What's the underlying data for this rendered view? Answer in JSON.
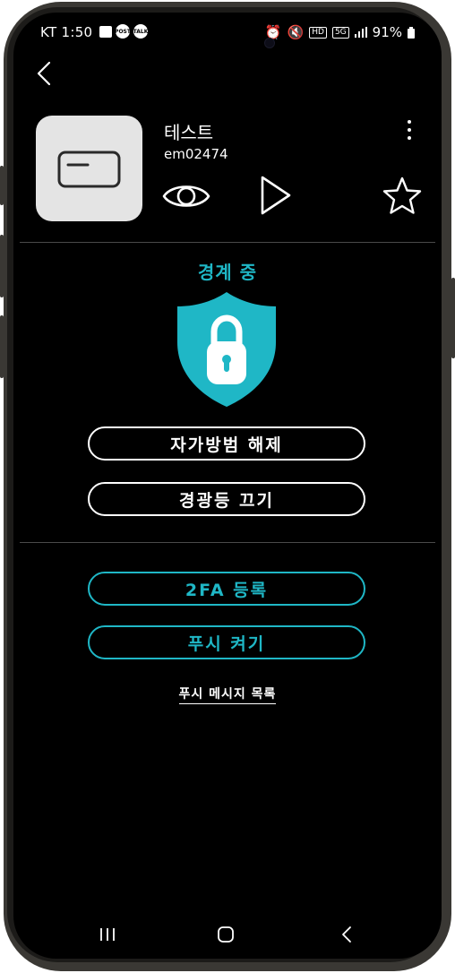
{
  "status_bar": {
    "carrier": "KT",
    "time": "1:50",
    "post_badge": "POST",
    "talk_badge": "TALK",
    "hd_label": "HD",
    "network_label": "5G",
    "battery": "91%"
  },
  "device": {
    "name": "테스트",
    "id": "em02474"
  },
  "security": {
    "status": "경계 중",
    "status_color": "#1fb7c6"
  },
  "actions": {
    "disarm": "자가방범 해제",
    "siren_off": "경광등 끄기",
    "register_2fa": "2FA 등록",
    "push_on": "푸시 켜기",
    "push_list": "푸시 메시지 목록"
  },
  "icons": {
    "back": "chevron-left-icon",
    "more": "more-vertical-icon",
    "view": "eye-icon",
    "play": "play-icon",
    "favorite": "star-icon",
    "device": "card-icon",
    "shield": "shield-lock-icon"
  }
}
